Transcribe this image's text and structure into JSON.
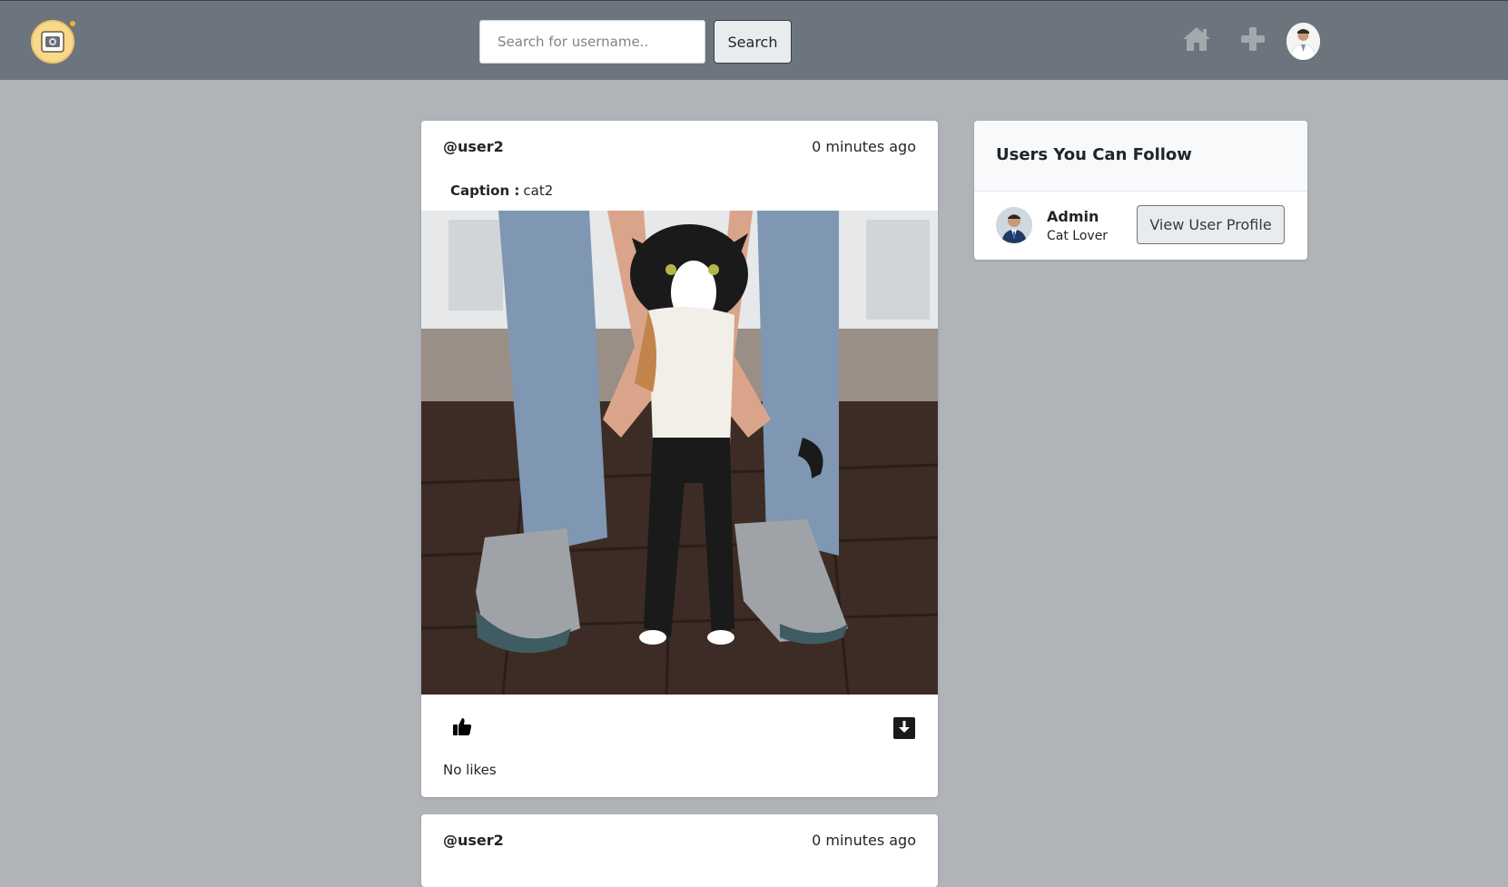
{
  "navbar": {
    "logo_icon": "camera-icon",
    "search": {
      "placeholder": "Search for username..",
      "value": "",
      "button_label": "Search"
    },
    "icons": [
      "home-icon",
      "plus-icon",
      "user-avatar"
    ],
    "background": "#6c757d"
  },
  "posts": [
    {
      "username": "@user2",
      "time": "0 minutes ago",
      "caption_label": "Caption :",
      "caption": "cat2",
      "image": "calico-cat-photo",
      "likes": "No likes",
      "icons": [
        "thumbs-up-icon",
        "download-icon"
      ]
    },
    {
      "username": "@user2",
      "time": "0 minutes ago"
    }
  ],
  "suggestions": {
    "title": "Users You Can Follow",
    "users": [
      {
        "name": "Admin",
        "bio": "Cat Lover",
        "button_label": "View User Profile"
      }
    ]
  },
  "colors": {
    "page_bg": "#b0b3b7",
    "card_bg": "#ffffff",
    "button_bg": "#e9ecef"
  }
}
